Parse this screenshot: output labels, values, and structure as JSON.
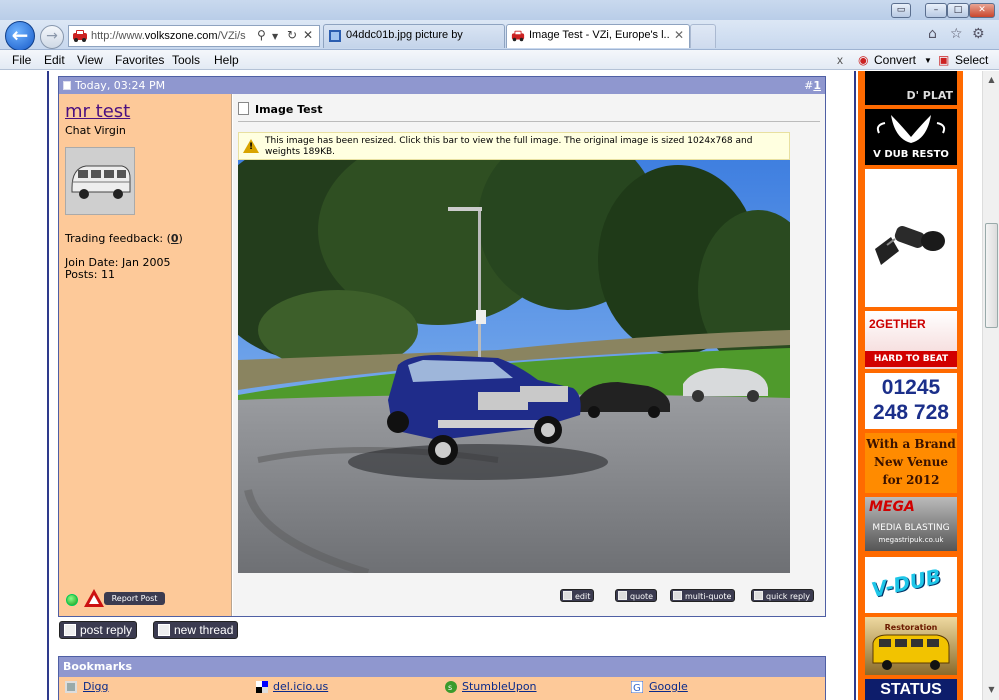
{
  "browser": {
    "address_url_dim": "http://www.",
    "address_url_domain": "volkszone.com",
    "address_url_rest": "/VZi/s",
    "tabs": [
      {
        "label": "04ddc01b.jpg picture by"
      },
      {
        "label": "Image Test - VZi, Europe's l..."
      }
    ],
    "menu": [
      "File",
      "Edit",
      "View",
      "Favorites",
      "Tools",
      "Help"
    ],
    "menu_right": {
      "close": "x",
      "convert": "Convert",
      "select": "Select"
    }
  },
  "post": {
    "date": "Today, 03:24 PM",
    "number_prefix": "#",
    "number": "1",
    "username": "mr test",
    "user_title": "Chat Virgin",
    "trading_feedback_label": "Trading feedback:",
    "trading_feedback_value": "0",
    "join_date": "Join Date: Jan 2005",
    "posts": "Posts: 11",
    "title": "Image Test",
    "resize_notice": "This image has been resized. Click this bar to view the full image. The original image is sized 1024x768 and weights 189KB.",
    "buttons": {
      "report": "Report Post",
      "edit": "edit",
      "quote": "quote",
      "multi_quote": "multi-quote",
      "quick_reply": "quick reply"
    }
  },
  "thread_buttons": {
    "post_reply": "post reply",
    "new_thread": "new thread"
  },
  "bookmarks": {
    "heading": "Bookmarks",
    "items": [
      "Digg",
      "del.icio.us",
      "StumbleUpon",
      "Google"
    ]
  },
  "ads": {
    "ad1": "D' PLAT",
    "ad2": "V DUB RESTO",
    "ad4_line1": "2GETHER",
    "ad4_line2": "HARD TO BEAT",
    "phone_line1": "01245",
    "phone_line2": "248 728",
    "brand_line1": "With a Brand",
    "brand_line2": "New Venue",
    "brand_line3": "for 2012",
    "mega": "MEGA",
    "mega_line1": "MEDIA BLASTING",
    "mega_line2": "megastripuk.co.uk",
    "vdub": "V-DUB",
    "restoration": "Restoration",
    "status": "STATUS"
  },
  "colors": {
    "post_header": "#8f97cf",
    "user_panel": "#fdc999",
    "border_blue": "#4f5fa4",
    "ads_orange": "#ff6a00"
  }
}
